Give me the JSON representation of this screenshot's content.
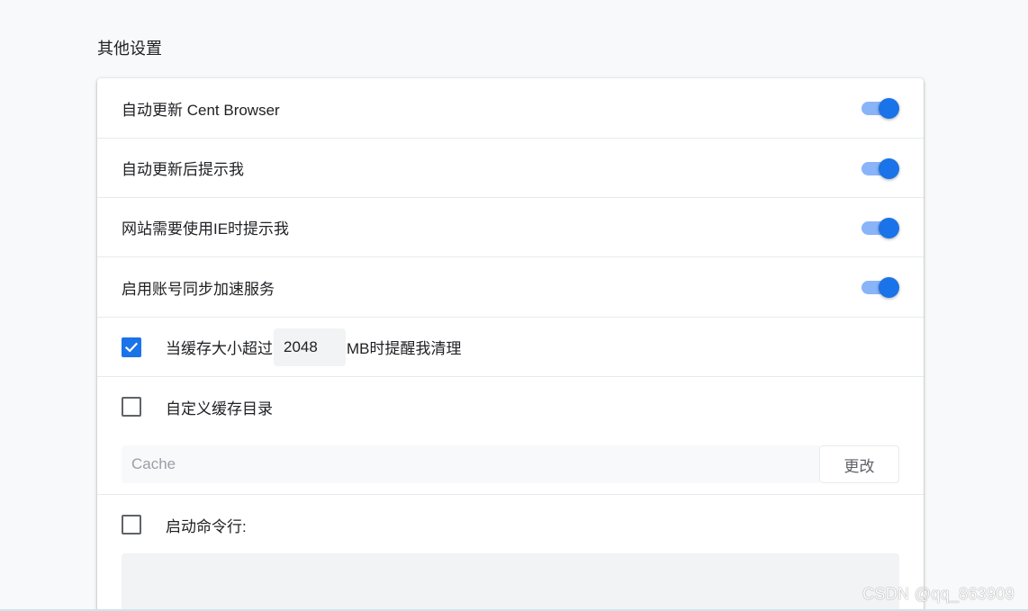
{
  "section": {
    "title": "其他设置"
  },
  "toggles": [
    {
      "label": "自动更新 Cent Browser",
      "on": true
    },
    {
      "label": "自动更新后提示我",
      "on": true
    },
    {
      "label": "网站需要使用IE时提示我",
      "on": true
    },
    {
      "label": "启用账号同步加速服务",
      "on": true
    }
  ],
  "cache_limit": {
    "checked": true,
    "prefix": "当缓存大小超过",
    "value": "2048",
    "suffix": "MB时提醒我清理"
  },
  "custom_cache_dir": {
    "checked": false,
    "label": "自定义缓存目录",
    "path_placeholder": "Cache",
    "change_label": "更改"
  },
  "command_line": {
    "checked": false,
    "label": "启动命令行:"
  },
  "watermark": "CSDN @qq_863909",
  "colors": {
    "accent": "#1a73e8",
    "toggle_track": "#8ab4f8"
  },
  "icons": {
    "checkmark": "check-icon"
  }
}
